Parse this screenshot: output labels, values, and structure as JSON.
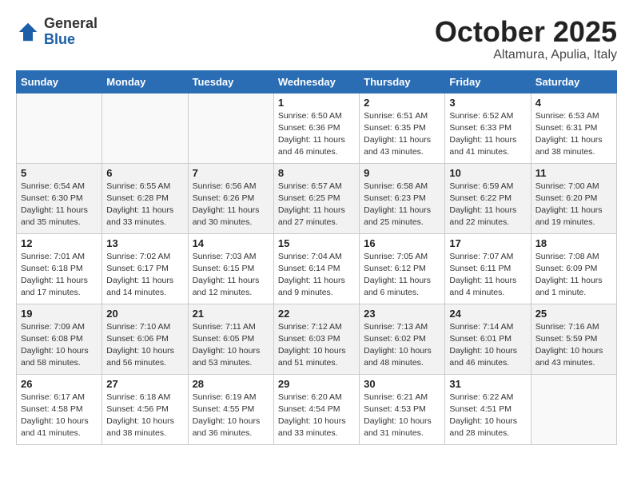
{
  "header": {
    "logo_general": "General",
    "logo_blue": "Blue",
    "month_title": "October 2025",
    "subtitle": "Altamura, Apulia, Italy"
  },
  "weekdays": [
    "Sunday",
    "Monday",
    "Tuesday",
    "Wednesday",
    "Thursday",
    "Friday",
    "Saturday"
  ],
  "weeks": [
    [
      {
        "day": "",
        "info": ""
      },
      {
        "day": "",
        "info": ""
      },
      {
        "day": "",
        "info": ""
      },
      {
        "day": "1",
        "info": "Sunrise: 6:50 AM\nSunset: 6:36 PM\nDaylight: 11 hours and 46 minutes."
      },
      {
        "day": "2",
        "info": "Sunrise: 6:51 AM\nSunset: 6:35 PM\nDaylight: 11 hours and 43 minutes."
      },
      {
        "day": "3",
        "info": "Sunrise: 6:52 AM\nSunset: 6:33 PM\nDaylight: 11 hours and 41 minutes."
      },
      {
        "day": "4",
        "info": "Sunrise: 6:53 AM\nSunset: 6:31 PM\nDaylight: 11 hours and 38 minutes."
      }
    ],
    [
      {
        "day": "5",
        "info": "Sunrise: 6:54 AM\nSunset: 6:30 PM\nDaylight: 11 hours and 35 minutes."
      },
      {
        "day": "6",
        "info": "Sunrise: 6:55 AM\nSunset: 6:28 PM\nDaylight: 11 hours and 33 minutes."
      },
      {
        "day": "7",
        "info": "Sunrise: 6:56 AM\nSunset: 6:26 PM\nDaylight: 11 hours and 30 minutes."
      },
      {
        "day": "8",
        "info": "Sunrise: 6:57 AM\nSunset: 6:25 PM\nDaylight: 11 hours and 27 minutes."
      },
      {
        "day": "9",
        "info": "Sunrise: 6:58 AM\nSunset: 6:23 PM\nDaylight: 11 hours and 25 minutes."
      },
      {
        "day": "10",
        "info": "Sunrise: 6:59 AM\nSunset: 6:22 PM\nDaylight: 11 hours and 22 minutes."
      },
      {
        "day": "11",
        "info": "Sunrise: 7:00 AM\nSunset: 6:20 PM\nDaylight: 11 hours and 19 minutes."
      }
    ],
    [
      {
        "day": "12",
        "info": "Sunrise: 7:01 AM\nSunset: 6:18 PM\nDaylight: 11 hours and 17 minutes."
      },
      {
        "day": "13",
        "info": "Sunrise: 7:02 AM\nSunset: 6:17 PM\nDaylight: 11 hours and 14 minutes."
      },
      {
        "day": "14",
        "info": "Sunrise: 7:03 AM\nSunset: 6:15 PM\nDaylight: 11 hours and 12 minutes."
      },
      {
        "day": "15",
        "info": "Sunrise: 7:04 AM\nSunset: 6:14 PM\nDaylight: 11 hours and 9 minutes."
      },
      {
        "day": "16",
        "info": "Sunrise: 7:05 AM\nSunset: 6:12 PM\nDaylight: 11 hours and 6 minutes."
      },
      {
        "day": "17",
        "info": "Sunrise: 7:07 AM\nSunset: 6:11 PM\nDaylight: 11 hours and 4 minutes."
      },
      {
        "day": "18",
        "info": "Sunrise: 7:08 AM\nSunset: 6:09 PM\nDaylight: 11 hours and 1 minute."
      }
    ],
    [
      {
        "day": "19",
        "info": "Sunrise: 7:09 AM\nSunset: 6:08 PM\nDaylight: 10 hours and 58 minutes."
      },
      {
        "day": "20",
        "info": "Sunrise: 7:10 AM\nSunset: 6:06 PM\nDaylight: 10 hours and 56 minutes."
      },
      {
        "day": "21",
        "info": "Sunrise: 7:11 AM\nSunset: 6:05 PM\nDaylight: 10 hours and 53 minutes."
      },
      {
        "day": "22",
        "info": "Sunrise: 7:12 AM\nSunset: 6:03 PM\nDaylight: 10 hours and 51 minutes."
      },
      {
        "day": "23",
        "info": "Sunrise: 7:13 AM\nSunset: 6:02 PM\nDaylight: 10 hours and 48 minutes."
      },
      {
        "day": "24",
        "info": "Sunrise: 7:14 AM\nSunset: 6:01 PM\nDaylight: 10 hours and 46 minutes."
      },
      {
        "day": "25",
        "info": "Sunrise: 7:16 AM\nSunset: 5:59 PM\nDaylight: 10 hours and 43 minutes."
      }
    ],
    [
      {
        "day": "26",
        "info": "Sunrise: 6:17 AM\nSunset: 4:58 PM\nDaylight: 10 hours and 41 minutes."
      },
      {
        "day": "27",
        "info": "Sunrise: 6:18 AM\nSunset: 4:56 PM\nDaylight: 10 hours and 38 minutes."
      },
      {
        "day": "28",
        "info": "Sunrise: 6:19 AM\nSunset: 4:55 PM\nDaylight: 10 hours and 36 minutes."
      },
      {
        "day": "29",
        "info": "Sunrise: 6:20 AM\nSunset: 4:54 PM\nDaylight: 10 hours and 33 minutes."
      },
      {
        "day": "30",
        "info": "Sunrise: 6:21 AM\nSunset: 4:53 PM\nDaylight: 10 hours and 31 minutes."
      },
      {
        "day": "31",
        "info": "Sunrise: 6:22 AM\nSunset: 4:51 PM\nDaylight: 10 hours and 28 minutes."
      },
      {
        "day": "",
        "info": ""
      }
    ]
  ]
}
